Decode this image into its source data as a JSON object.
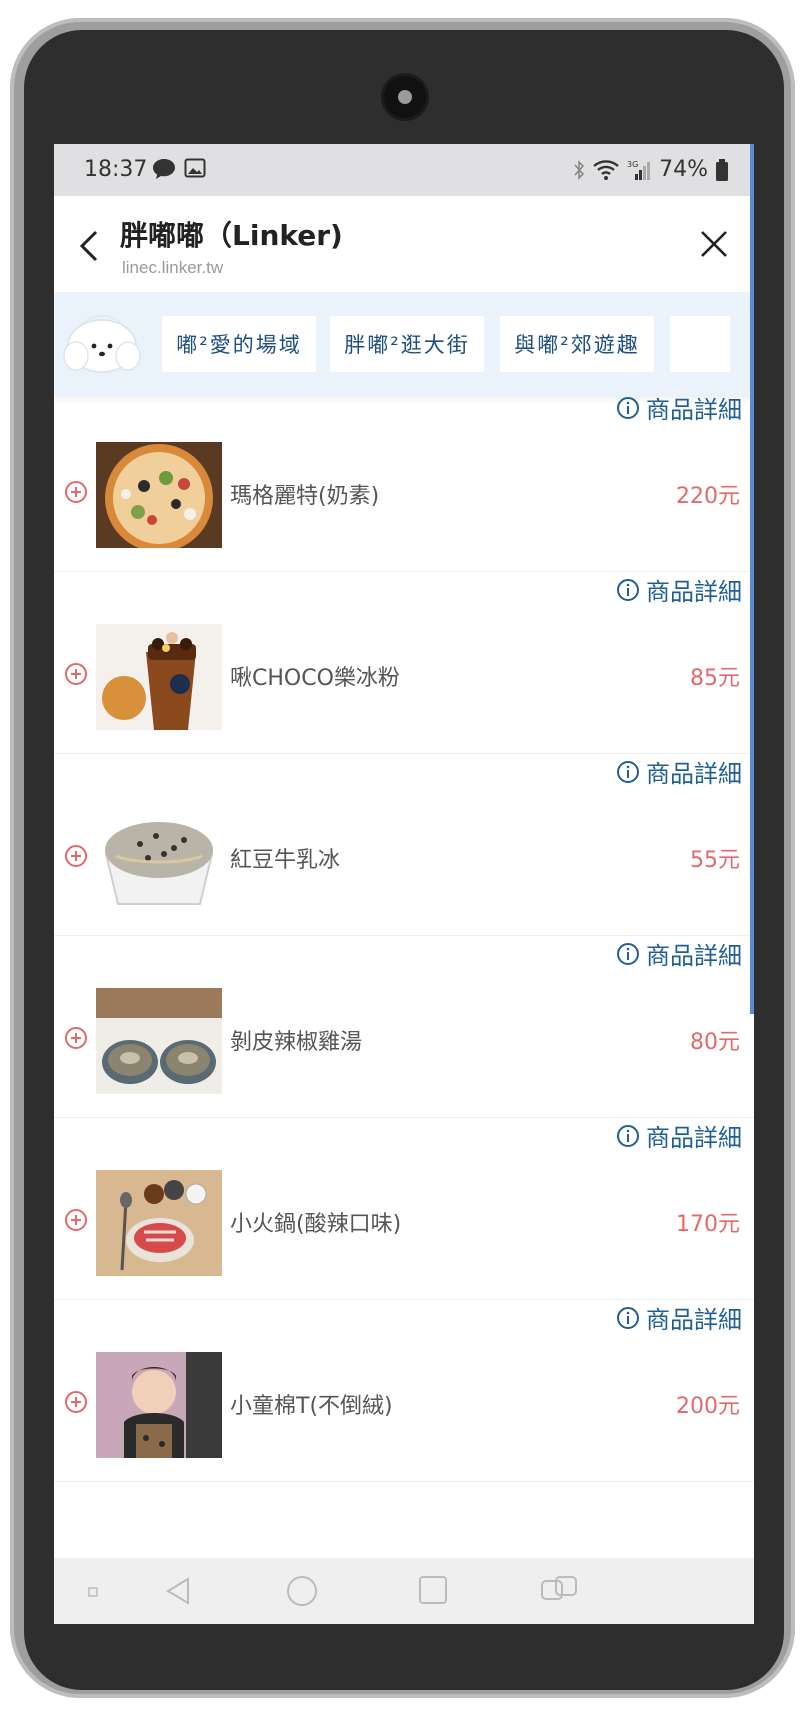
{
  "status_bar": {
    "time": "18:37",
    "battery": "74%",
    "network": "3G"
  },
  "header": {
    "title": "胖嘟嘟（Linker)",
    "subtitle": "linec.linker.tw"
  },
  "categories": [
    {
      "label": "嘟²愛的場域"
    },
    {
      "label": "胖嘟²逛大街"
    },
    {
      "label": "與嘟²郊遊趣"
    }
  ],
  "detail_label": "商品詳細",
  "products": [
    {
      "name": "瑪格麗特(奶素)",
      "price": "220元",
      "thumb_icon": "pizza-photo"
    },
    {
      "name": "啾CHOCO樂冰粉",
      "price": "85元",
      "thumb_icon": "choco-drink-photo"
    },
    {
      "name": "紅豆牛乳冰",
      "price": "55元",
      "thumb_icon": "shaved-ice-photo"
    },
    {
      "name": "剝皮辣椒雞湯",
      "price": "80元",
      "thumb_icon": "chicken-soup-photo"
    },
    {
      "name": "小火鍋(酸辣口味)",
      "price": "170元",
      "thumb_icon": "hotpot-photo"
    },
    {
      "name": "小童棉T(不倒絨)",
      "price": "200元",
      "thumb_icon": "kids-tshirt-photo"
    }
  ],
  "colors": {
    "accent_blue": "#1f5f96",
    "price_red": "#e36a6a",
    "category_bg": "#eaf3fb"
  }
}
